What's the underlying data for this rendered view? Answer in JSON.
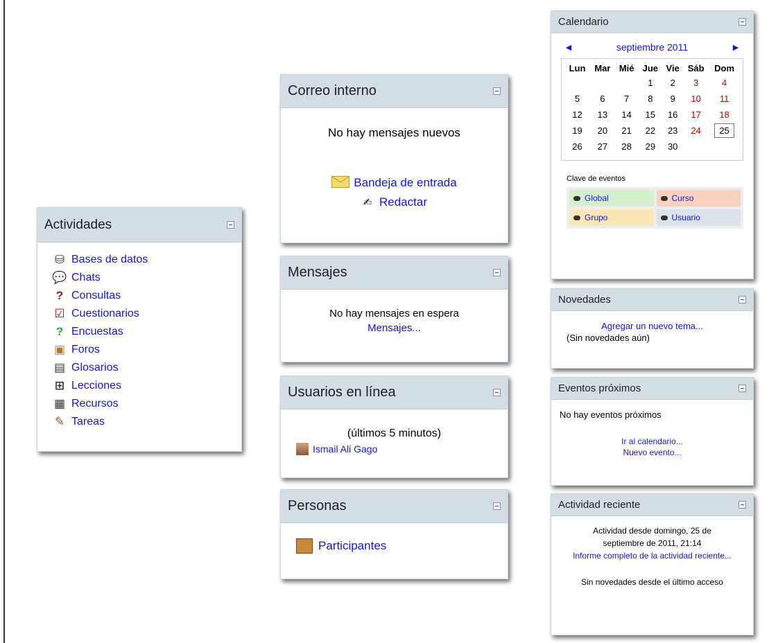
{
  "actividades": {
    "title": "Actividades",
    "items": [
      {
        "label": "Bases de datos",
        "icon": "database-icon"
      },
      {
        "label": "Chats",
        "icon": "chat-bubble-icon"
      },
      {
        "label": "Consultas",
        "icon": "question-icon"
      },
      {
        "label": "Cuestionarios",
        "icon": "checklist-icon"
      },
      {
        "label": "Encuestas",
        "icon": "survey-icon"
      },
      {
        "label": "Foros",
        "icon": "forum-icon"
      },
      {
        "label": "Glosarios",
        "icon": "glossary-icon"
      },
      {
        "label": "Lecciones",
        "icon": "lesson-icon"
      },
      {
        "label": "Recursos",
        "icon": "resource-icon"
      },
      {
        "label": "Tareas",
        "icon": "assignment-icon"
      }
    ]
  },
  "correo": {
    "title": "Correo interno",
    "status": "No hay mensajes nuevos",
    "inbox_label": "Bandeja de entrada",
    "compose_label": "Redactar"
  },
  "mensajes": {
    "title": "Mensajes",
    "status": "No hay mensajes en espera",
    "link": "Mensajes..."
  },
  "usuarios": {
    "title": "Usuarios en línea",
    "period": "(últimos 5 minutos)",
    "user": "Ismail Ali Gago"
  },
  "personas": {
    "title": "Personas",
    "link": "Participantes"
  },
  "calendario": {
    "title": "Calendario",
    "prev": "◄",
    "month": "septiembre 2011",
    "next": "►",
    "weekdays": [
      "Lun",
      "Mar",
      "Mié",
      "Jue",
      "Vie",
      "Sáb",
      "Dom"
    ],
    "weeks": [
      [
        "",
        "",
        "",
        "1",
        "2",
        "3",
        "4"
      ],
      [
        "5",
        "6",
        "7",
        "8",
        "9",
        "10",
        "11"
      ],
      [
        "12",
        "13",
        "14",
        "15",
        "16",
        "17",
        "18"
      ],
      [
        "19",
        "20",
        "21",
        "22",
        "23",
        "24",
        "25"
      ],
      [
        "26",
        "27",
        "28",
        "29",
        "30",
        "",
        ""
      ]
    ],
    "today": "25",
    "key_title": "Clave de eventos",
    "key": [
      {
        "label": "Global",
        "color": "#d6f0cf"
      },
      {
        "label": "Curso",
        "color": "#f8d2bf"
      },
      {
        "label": "Grupo",
        "color": "#fbe6b7"
      },
      {
        "label": "Usuario",
        "color": "#dde3ea"
      }
    ]
  },
  "novedades": {
    "title": "Novedades",
    "link": "Agregar un nuevo tema...",
    "status": "(Sin novedades aún)"
  },
  "eventos": {
    "title": "Eventos próximos",
    "status": "No hay eventos próximos",
    "link1": "Ir al calendario...",
    "link2": "Nuevo evento..."
  },
  "reciente": {
    "title": "Actividad reciente",
    "since": "Actividad desde domingo, 25 de septiembre de 2011, 21:14",
    "link": "Informe completo de la actividad reciente...",
    "status": "Sin novedades desde el último acceso"
  }
}
